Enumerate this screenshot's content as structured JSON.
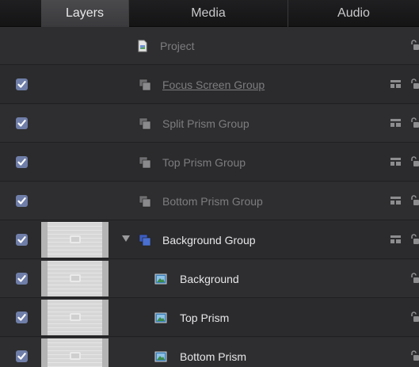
{
  "tabs": [
    {
      "label": "Layers",
      "selected": true
    },
    {
      "label": "Media",
      "selected": false
    },
    {
      "label": "Audio",
      "selected": false
    }
  ],
  "rows": [
    {
      "label": "Project",
      "kind": "project",
      "checkbox": false,
      "thumbnail": false,
      "dim": true,
      "underline": false,
      "disclosure": false,
      "indent": 0,
      "group_icons": false
    },
    {
      "label": "Focus Screen Group",
      "kind": "group",
      "checkbox": true,
      "thumbnail": false,
      "dim": true,
      "underline": true,
      "disclosure": false,
      "indent": 0,
      "group_icons": true
    },
    {
      "label": "Split Prism Group",
      "kind": "group",
      "checkbox": true,
      "thumbnail": false,
      "dim": true,
      "underline": false,
      "disclosure": false,
      "indent": 0,
      "group_icons": true
    },
    {
      "label": "Top Prism Group",
      "kind": "group",
      "checkbox": true,
      "thumbnail": false,
      "dim": true,
      "underline": false,
      "disclosure": false,
      "indent": 0,
      "group_icons": true
    },
    {
      "label": "Bottom Prism Group",
      "kind": "group",
      "checkbox": true,
      "thumbnail": false,
      "dim": true,
      "underline": false,
      "disclosure": false,
      "indent": 0,
      "group_icons": true
    },
    {
      "label": "Background Group",
      "kind": "group-active",
      "checkbox": true,
      "thumbnail": true,
      "dim": false,
      "underline": false,
      "disclosure": true,
      "indent": 0,
      "group_icons": true
    },
    {
      "label": "Background",
      "kind": "image",
      "checkbox": true,
      "thumbnail": true,
      "dim": false,
      "underline": false,
      "disclosure": false,
      "indent": 1,
      "group_icons": false
    },
    {
      "label": "Top Prism",
      "kind": "image",
      "checkbox": true,
      "thumbnail": true,
      "dim": false,
      "underline": false,
      "disclosure": false,
      "indent": 1,
      "group_icons": false
    },
    {
      "label": "Bottom Prism",
      "kind": "image",
      "checkbox": true,
      "thumbnail": true,
      "dim": false,
      "underline": false,
      "disclosure": false,
      "indent": 1,
      "group_icons": false
    }
  ],
  "colors": {
    "checkbox": "#6f7ea8",
    "group_icon_active": "#4a6fd1",
    "group_icon_dim": "#8a8a8d"
  }
}
